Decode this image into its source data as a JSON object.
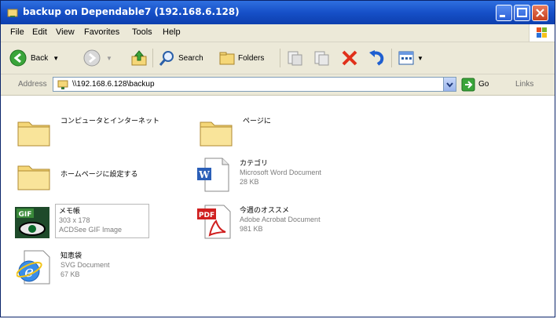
{
  "window": {
    "title": "backup on Dependable7 (192.168.6.128)"
  },
  "menu": {
    "items": [
      "File",
      "Edit",
      "View",
      "Favorites",
      "Tools",
      "Help"
    ]
  },
  "toolbar": {
    "back_label": "Back",
    "search_label": "Search",
    "folders_label": "Folders"
  },
  "address": {
    "label": "Address",
    "value": "\\\\192.168.6.128\\backup",
    "go_label": "Go",
    "links_label": "Links"
  },
  "files": [
    {
      "name": "コンピュータとインターネット",
      "type": "",
      "size": "",
      "icon": "folder-icon"
    },
    {
      "name": "ページに",
      "type": "",
      "size": "",
      "icon": "folder-icon"
    },
    {
      "name": "ホームページに設定する",
      "type": "",
      "size": "",
      "icon": "folder-icon"
    },
    {
      "name": "カテゴリ",
      "type": "Microsoft Word Document",
      "size": "28 KB",
      "icon": "word-icon"
    },
    {
      "name": "メモ帳",
      "type": "303 x 178",
      "size": "ACDSee GIF Image",
      "icon": "gif-icon"
    },
    {
      "name": "今週のオススメ",
      "type": "Adobe Acrobat Document",
      "size": "981 KB",
      "icon": "pdf-icon"
    },
    {
      "name": "知恵袋",
      "type": "SVG Document",
      "size": "67 KB",
      "icon": "ie-icon"
    }
  ],
  "colors": {
    "titlebar": "#1650c8",
    "chrome": "#ece9d8",
    "folder": "#f5d778",
    "close_button": "#c7401e"
  }
}
